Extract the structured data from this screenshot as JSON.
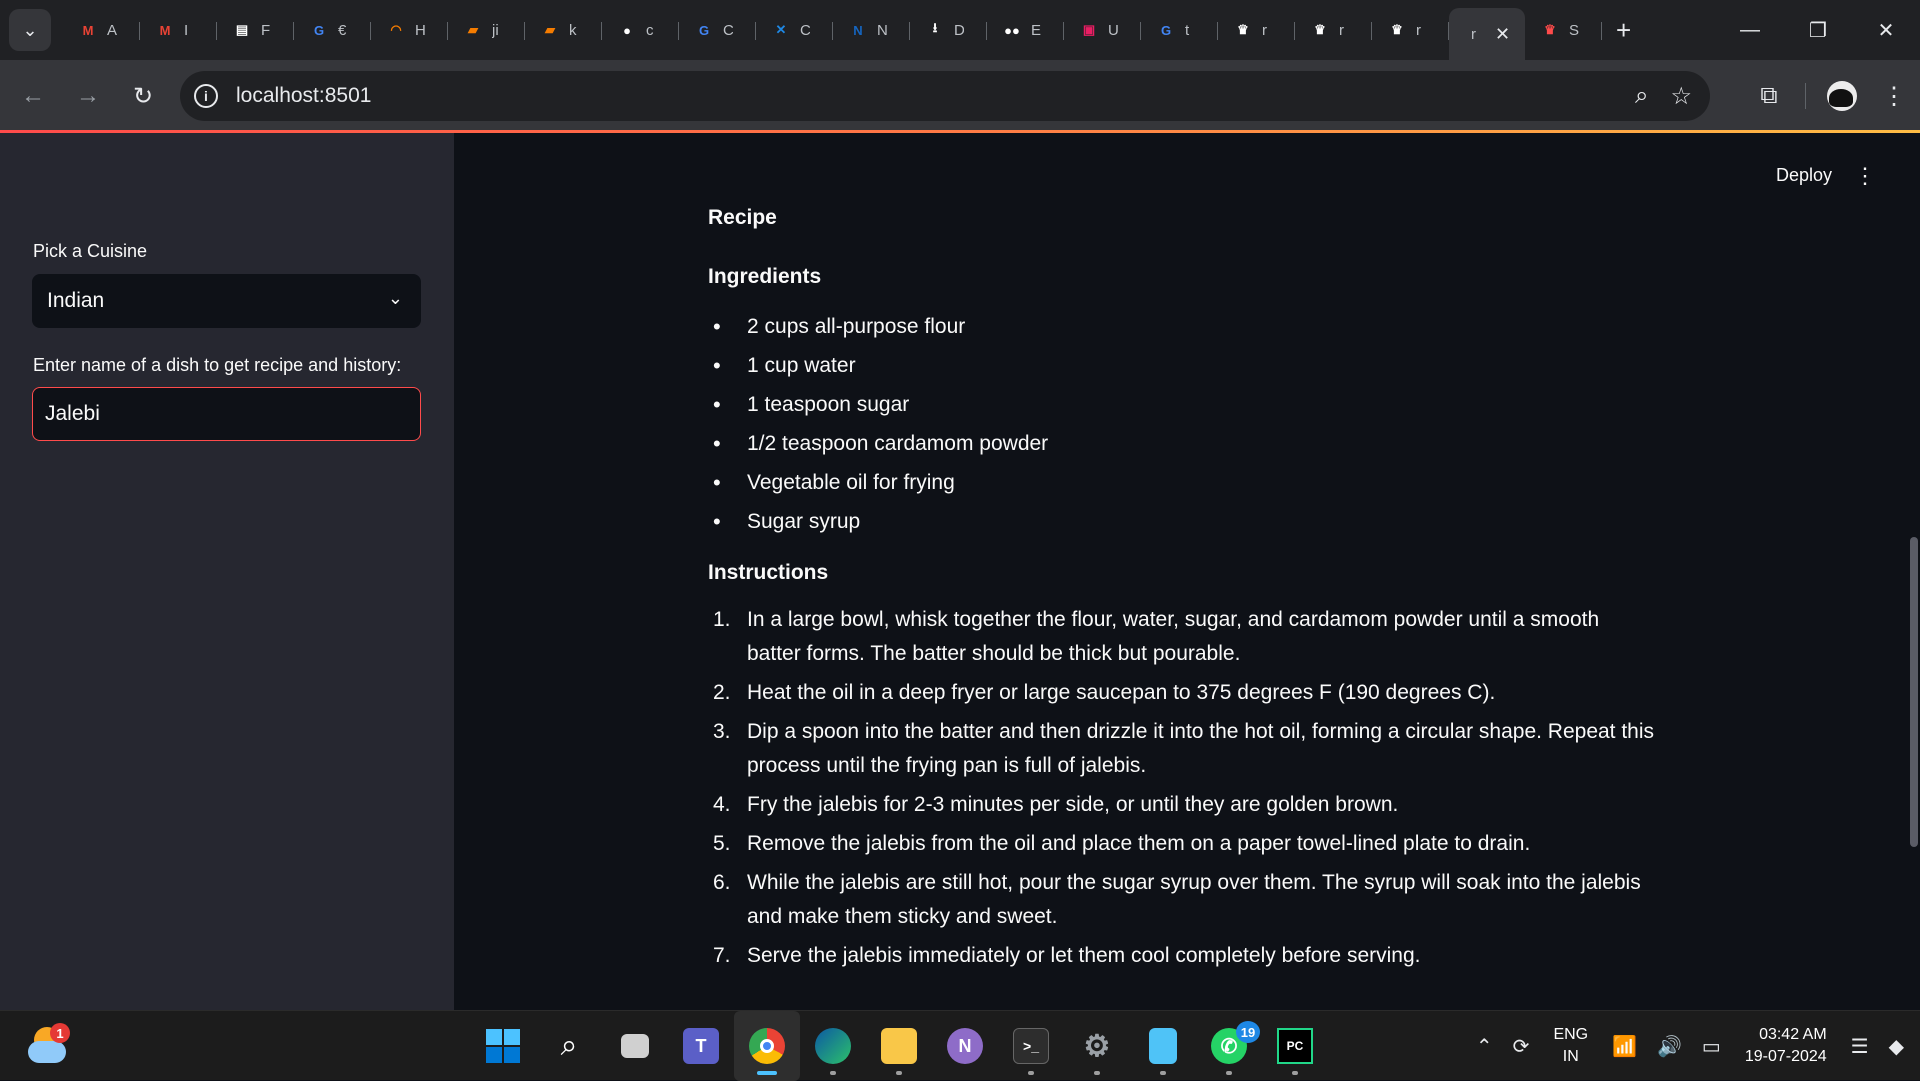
{
  "browser": {
    "tabs": [
      {
        "name": "gmail-1",
        "title": "A",
        "icon": "gmail-icon",
        "color": "#ea4335",
        "glyph": "M"
      },
      {
        "name": "gmail-2",
        "title": "I",
        "icon": "gmail-icon",
        "color": "#ea4335",
        "glyph": "M"
      },
      {
        "name": "doc",
        "title": "F",
        "icon": "document-icon",
        "color": "#ffffff",
        "glyph": "▤"
      },
      {
        "name": "google-1",
        "title": "€",
        "icon": "google-icon",
        "color": "#4285f4",
        "glyph": "G"
      },
      {
        "name": "loading",
        "title": "H",
        "icon": "loading-icon",
        "color": "#f57c00",
        "glyph": "◠"
      },
      {
        "name": "notes-1",
        "title": "ji",
        "icon": "notebook-icon",
        "color": "#f57c00",
        "glyph": "▰"
      },
      {
        "name": "notes-2",
        "title": "k",
        "icon": "notebook-icon",
        "color": "#f57c00",
        "glyph": "▰"
      },
      {
        "name": "github",
        "title": "c",
        "icon": "github-icon",
        "color": "#ffffff",
        "glyph": "●"
      },
      {
        "name": "google-2",
        "title": "C",
        "icon": "google-icon",
        "color": "#4285f4",
        "glyph": "G"
      },
      {
        "name": "butterfly",
        "title": "C",
        "icon": "butterfly-icon",
        "color": "#1e88e5",
        "glyph": "✕"
      },
      {
        "name": "notion-like",
        "title": "N",
        "icon": "app-icon",
        "color": "#1565c0",
        "glyph": "N"
      },
      {
        "name": "download",
        "title": "D",
        "icon": "download-icon",
        "color": "#ffffff",
        "glyph": "⭳"
      },
      {
        "name": "medium",
        "title": "E",
        "icon": "medium-icon",
        "color": "#ffffff",
        "glyph": "●●"
      },
      {
        "name": "app-red",
        "title": "U",
        "icon": "app-icon",
        "color": "#e91e63",
        "glyph": "▣"
      },
      {
        "name": "google-3",
        "title": "t",
        "icon": "google-icon",
        "color": "#4285f4",
        "glyph": "G"
      },
      {
        "name": "streamlit-1",
        "title": "r",
        "icon": "streamlit-icon",
        "color": "#ffffff",
        "glyph": "♛"
      },
      {
        "name": "streamlit-2",
        "title": "r",
        "icon": "streamlit-icon",
        "color": "#ffffff",
        "glyph": "♛"
      },
      {
        "name": "streamlit-3",
        "title": "r",
        "icon": "streamlit-icon",
        "color": "#ffffff",
        "glyph": "♛"
      }
    ],
    "active_tab": {
      "title": "r",
      "close": "✕"
    },
    "last_tab": {
      "title": "S",
      "icon": "streamlit-icon",
      "color": "#ff4b4b",
      "glyph": "♛"
    },
    "url": "localhost:8501"
  },
  "app": {
    "sidebar": {
      "cuisine_label": "Pick a Cuisine",
      "cuisine_value": "Indian",
      "dish_label": "Enter name of a dish to get recipe and history:",
      "dish_value": "Jalebi"
    },
    "header": {
      "deploy": "Deploy"
    },
    "content": {
      "recipe_heading": "Recipe",
      "ingredients_heading": "Ingredients",
      "ingredients": [
        "2 cups all-purpose flour",
        "1 cup water",
        "1 teaspoon sugar",
        "1/2 teaspoon cardamom powder",
        "Vegetable oil for frying",
        "Sugar syrup"
      ],
      "instructions_heading": "Instructions",
      "instructions": [
        "In a large bowl, whisk together the flour, water, sugar, and cardamom powder until a smooth batter forms. The batter should be thick but pourable.",
        "Heat the oil in a deep fryer or large saucepan to 375 degrees F (190 degrees C).",
        "Dip a spoon into the batter and then drizzle it into the hot oil, forming a circular shape. Repeat this process until the frying pan is full of jalebis.",
        "Fry the jalebis for 2-3 minutes per side, or until they are golden brown.",
        "Remove the jalebis from the oil and place them on a paper towel-lined plate to drain.",
        "While the jalebis are still hot, pour the sugar syrup over them. The syrup will soak into the jalebis and make them sticky and sweet.",
        "Serve the jalebis immediately or let them cool completely before serving."
      ]
    }
  },
  "taskbar": {
    "weather_badge": "1",
    "whatsapp_badge": "19",
    "language": {
      "line1": "ENG",
      "line2": "IN"
    },
    "time": "03:42 AM",
    "date": "19-07-2024"
  },
  "colors": {
    "accent": "#ff4b4b",
    "sidebar_bg": "#262730",
    "main_bg": "#0e1117"
  }
}
